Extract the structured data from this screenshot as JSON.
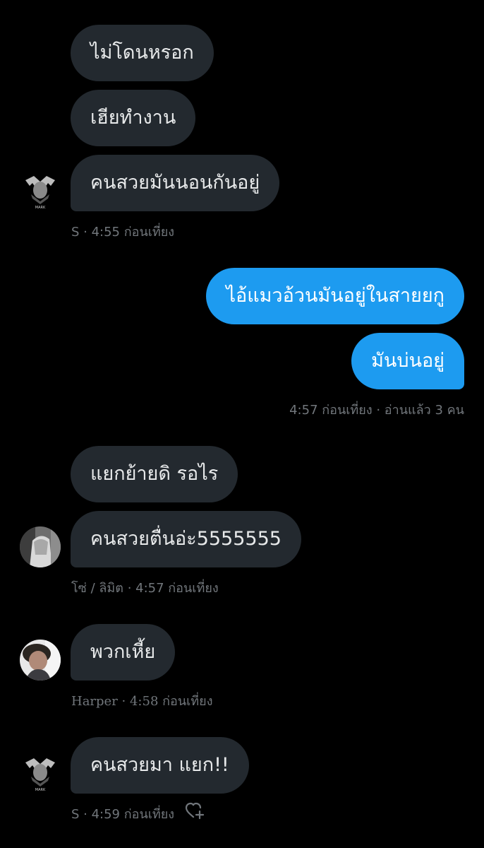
{
  "colors": {
    "background": "#000000",
    "incoming_bubble": "#23292f",
    "outgoing_bubble": "#1d9bf0",
    "meta_text": "#71767b"
  },
  "messages": [
    {
      "text": "ไม่โดนหรอก",
      "side": "incoming"
    },
    {
      "text": "เฮียทำงาน",
      "side": "incoming"
    },
    {
      "text": "คนสวยมันนอนกันอยู่",
      "side": "incoming"
    },
    {
      "text": "ไอ้แมวอ้วนมันอยู่ในสายยกู",
      "side": "outgoing"
    },
    {
      "text": "มันบ่นอยู่",
      "side": "outgoing"
    },
    {
      "text": "แยกย้ายดิ รอไร",
      "side": "incoming"
    },
    {
      "text": "คนสวยตื่นอ่ะ5555555",
      "side": "incoming"
    },
    {
      "text": "พวกเหี้ย",
      "side": "incoming"
    },
    {
      "text": "คนสวยมา แยก!!",
      "side": "incoming"
    }
  ],
  "meta": [
    "S · 4:55 ก่อนเที่ยง",
    "4:57 ก่อนเที่ยง · อ่านแล้ว 3 คน",
    "โซ่ / ลิมิต · 4:57 ก่อนเที่ยง",
    "Harper · 4:58 ก่อนเที่ยง",
    "S · 4:59 ก่อนเที่ยง"
  ],
  "avatar_badge": "MARK",
  "icons": {
    "react": "heart-plus-icon"
  }
}
